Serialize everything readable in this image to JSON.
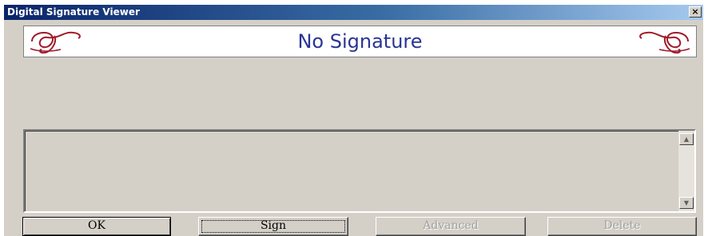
{
  "window": {
    "title": "Digital Signature Viewer",
    "close_symbol": "×"
  },
  "banner": {
    "status_text": "No Signature",
    "text_color": "#283593",
    "logo_color": "#a01a2a",
    "logo_icons": [
      "signature-flourish-left-icon",
      "signature-flourish-right-icon"
    ]
  },
  "details": {
    "text": ""
  },
  "scrollbar": {
    "up_icon": "▲",
    "down_icon": "▼"
  },
  "buttons": {
    "ok": "OK",
    "sign": "Sign",
    "advanced": "Advanced",
    "delete": "Delete"
  },
  "colors": {
    "titlebar_start": "#0a246a",
    "titlebar_end": "#a6caf0",
    "dialog_bg": "#d4d0c8"
  }
}
